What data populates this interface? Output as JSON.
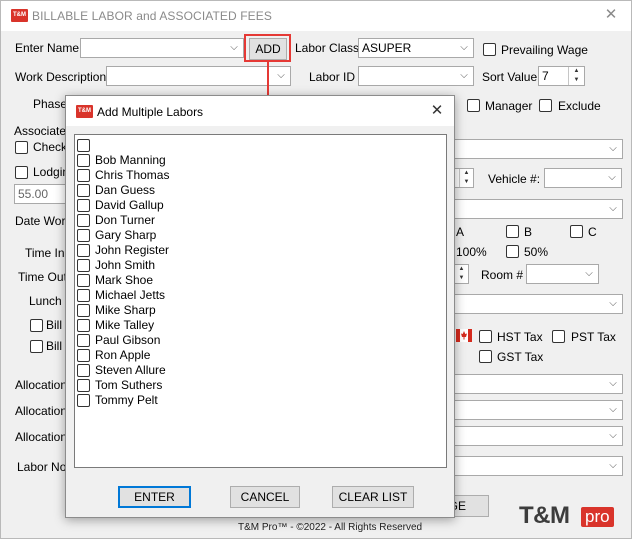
{
  "main_window": {
    "title": "BILLABLE LABOR and ASSOCIATED FEES",
    "logo": "T&M",
    "close_glyph": "✕",
    "enter_name_label": "Enter Name",
    "enter_name_value": "",
    "add_button": "ADD",
    "labor_class_label": "Labor Class",
    "labor_class_value": "ASUPER",
    "prevailing_wage_label": "Prevailing Wage",
    "work_description_label": "Work Description",
    "labor_id_label": "Labor ID",
    "sort_value_label": "Sort Value",
    "sort_value": "7",
    "phase_label": "Phase (",
    "manager_label": "Manager",
    "exclude_label": "Exclude",
    "associated_label": "Associated",
    "check_label": "Check",
    "lodging_label": "Lodging",
    "amount_value": "55.00",
    "vehicle_label": "Vehicle #:",
    "date_work_label": "Date Work",
    "a_label": "A",
    "b_label": "B",
    "c_label": "C",
    "pct100_label": "100%",
    "pct50_label": "50%",
    "time_in_label": "Time In",
    "time_out_label": "Time Out",
    "room_label": "Room #",
    "lunch_label": "Lunch",
    "bill_f_label": "Bill F",
    "bill_a_label": "Bill a",
    "hst_label": "HST Tax",
    "pst_label": "PST Tax",
    "gst_label": "GST Tax",
    "allocation_label_1": "Allocation :",
    "allocation_label_2": "Allocation :",
    "allocation_label_3": "Allocation :",
    "labor_notes_label": "Labor Note",
    "bg_button_fragment": "GE",
    "footer": "T&M Pro™ - ©2022 - All Rights Reserved",
    "brand_tm": "T&M",
    "brand_pro": "pro"
  },
  "dialog": {
    "title": "Add Multiple Labors",
    "logo": "T&M",
    "close_glyph": "✕",
    "items": [
      "",
      "Bob Manning",
      "Chris Thomas",
      "Dan Guess",
      "David Gallup",
      "Don Turner",
      "Gary Sharp",
      "John Register",
      "John Smith",
      "Mark Shoe",
      "Michael Jetts",
      "Mike Sharp",
      "Mike Talley",
      "Paul Gibson",
      "Ron Apple",
      "Steven Allure",
      "Tom Suthers",
      "Tommy Pelt"
    ],
    "enter_button": "ENTER",
    "cancel_button": "CANCEL",
    "clear_button": "CLEAR LIST"
  },
  "colors": {
    "accent_red": "#e53935",
    "brand_red": "#d9342b",
    "canada_flag": "#d52b1e"
  }
}
